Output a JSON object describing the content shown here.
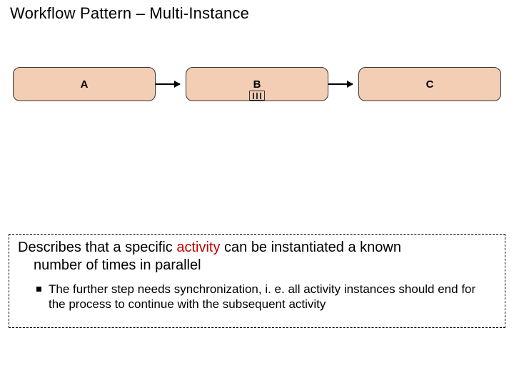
{
  "title": "Workflow Pattern – Multi-Instance",
  "diagram": {
    "nodes": [
      {
        "label": "A",
        "multi_instance": false
      },
      {
        "label": "B",
        "multi_instance": true
      },
      {
        "label": "C",
        "multi_instance": false
      }
    ],
    "edges": [
      {
        "from": "A",
        "to": "B"
      },
      {
        "from": "B",
        "to": "C"
      }
    ]
  },
  "description": {
    "main_pre": "Describes that a specific ",
    "main_highlight": "activity",
    "main_mid": " can be instantiated a known",
    "main_line2": "number of times in parallel",
    "bullet": "The further step needs synchronization, i. e. all activity instances should end for the process to continue with the subsequent activity"
  }
}
